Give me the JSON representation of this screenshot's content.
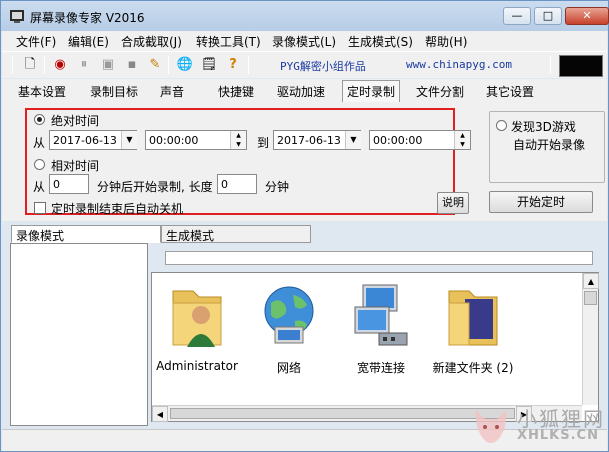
{
  "window": {
    "title": "屏幕录像专家 V2016"
  },
  "titlebar_buttons": {
    "minimize": "—",
    "maximize": "□",
    "close": "✕"
  },
  "menu": [
    "文件(F)",
    "编辑(E)",
    "合成截取(J)",
    "转换工具(T)",
    "录像模式(L)",
    "生成模式(S)",
    "帮助(H)"
  ],
  "toolbar": {
    "icons": [
      "new-file-icon",
      "record-icon",
      "pause-icon",
      "stop-icon",
      "camera-icon",
      "pen-icon",
      "globe-icon",
      "notes-icon",
      "help-icon"
    ],
    "glyphs": [
      "🗋",
      "◉",
      "⏸",
      "▣",
      "▪",
      "✎",
      "🌐",
      "🗒",
      "?"
    ],
    "credit": "PYG解密小组作品",
    "url": "www.chinapyg.com"
  },
  "tabs": [
    "基本设置",
    "录制目标",
    "声音",
    "快捷键",
    "驱动加速",
    "定时录制",
    "文件分割",
    "其它设置"
  ],
  "active_tab_index": 5,
  "timer": {
    "absolute_label": "绝对时间",
    "from_label": "从",
    "to_label": "到",
    "start_date": "2017-06-13",
    "start_time": "00:00:00",
    "end_date": "2017-06-13",
    "end_time": "00:00:00",
    "relative_label": "相对时间",
    "rel_from_label": "从",
    "rel_start_minutes": "0",
    "rel_middle_label": "分钟后开始录制, 长度",
    "rel_length_minutes": "0",
    "rel_unit": "分钟",
    "shutdown_label": "定时录制结束后自动关机",
    "help_button": "说明"
  },
  "side": {
    "detect_3d_label": "发现3D游戏",
    "auto_record_label": "自动开始录像",
    "start_timer_button": "开始定时"
  },
  "bottom_tabs": [
    "录像模式",
    "生成模式"
  ],
  "files": [
    {
      "label": "Administrator",
      "icon": "user-folder-icon"
    },
    {
      "label": "网络",
      "icon": "network-globe-icon"
    },
    {
      "label": "宽带连接",
      "icon": "broadband-connection-icon"
    },
    {
      "label": "新建文件夹 (2)",
      "icon": "folder-icon"
    }
  ],
  "watermark": {
    "text": "小狐狸网",
    "url": "XHLKS.CN"
  },
  "colors": {
    "highlight_border": "#e02020",
    "title_gradient": "#b7cde6"
  }
}
